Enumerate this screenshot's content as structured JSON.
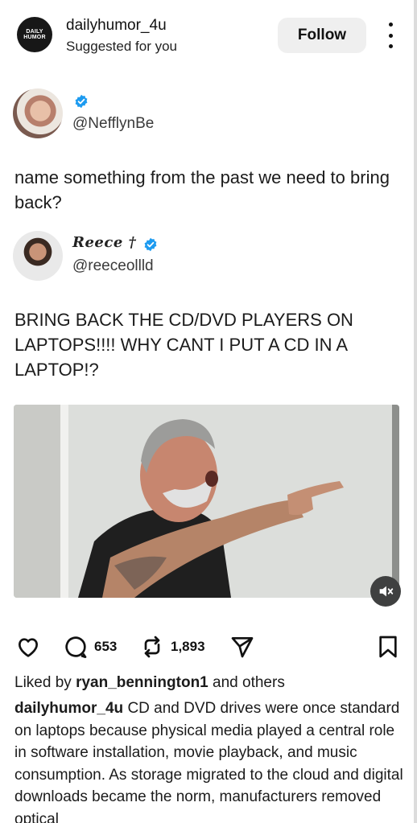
{
  "post": {
    "account_name": "dailyhumor_4u",
    "account_sub": "Suggested for you",
    "logo_lines": [
      "DAILY",
      "HUMOR"
    ],
    "follow_label": "Follow"
  },
  "tweet1": {
    "handle": "@NefflynBe",
    "text": "name something from the past we need to bring back?"
  },
  "tweet2": {
    "name": "Reece †",
    "handle": "@reeceollld",
    "text": "BRING BACK THE CD/DVD PLAYERS ON LAPTOPS!!!! WHY CANT I PUT A CD IN A LAPTOP!?"
  },
  "actions": {
    "comments": "653",
    "reposts": "1,893"
  },
  "likes": {
    "prefix": "Liked by",
    "user": "ryan_bennington1",
    "suffix": "and others"
  },
  "caption": {
    "user": "dailyhumor_4u",
    "text": "CD and DVD drives were once standard on laptops because physical media played a central role in software installation, movie playback, and music consumption. As storage migrated to the cloud and digital downloads became the norm, manufacturers removed optical"
  },
  "icons": [
    "more-vertical-icon",
    "verified-badge-icon",
    "mute-icon",
    "heart-icon",
    "comment-icon",
    "repost-icon",
    "share-icon",
    "bookmark-icon"
  ],
  "colors": {
    "verified": "#1d9bf0",
    "follow_bg": "#efefef",
    "mute_bg": "#3f4040"
  }
}
